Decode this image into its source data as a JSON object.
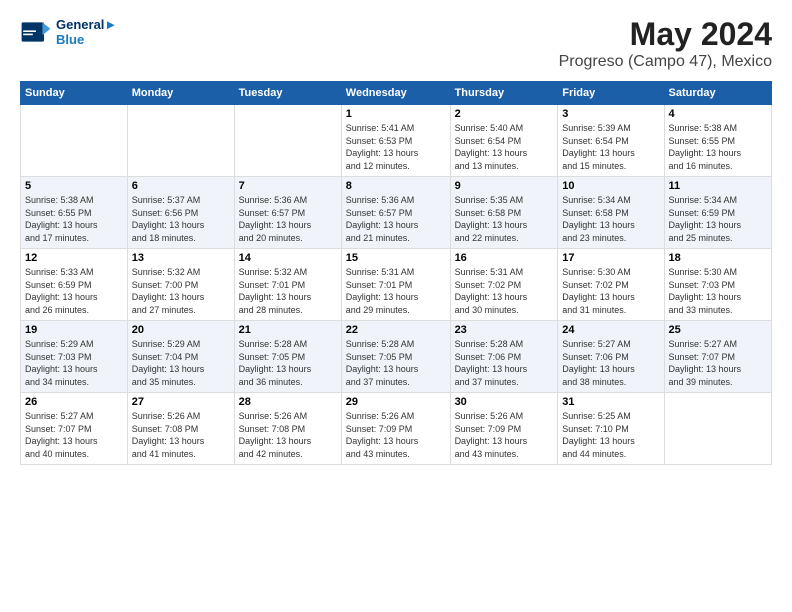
{
  "header": {
    "logo_line1": "General",
    "logo_line2": "Blue",
    "main_title": "May 2024",
    "subtitle": "Progreso (Campo 47), Mexico"
  },
  "days_of_week": [
    "Sunday",
    "Monday",
    "Tuesday",
    "Wednesday",
    "Thursday",
    "Friday",
    "Saturday"
  ],
  "weeks": [
    [
      {
        "day": "",
        "info": ""
      },
      {
        "day": "",
        "info": ""
      },
      {
        "day": "",
        "info": ""
      },
      {
        "day": "1",
        "info": "Sunrise: 5:41 AM\nSunset: 6:53 PM\nDaylight: 13 hours\nand 12 minutes."
      },
      {
        "day": "2",
        "info": "Sunrise: 5:40 AM\nSunset: 6:54 PM\nDaylight: 13 hours\nand 13 minutes."
      },
      {
        "day": "3",
        "info": "Sunrise: 5:39 AM\nSunset: 6:54 PM\nDaylight: 13 hours\nand 15 minutes."
      },
      {
        "day": "4",
        "info": "Sunrise: 5:38 AM\nSunset: 6:55 PM\nDaylight: 13 hours\nand 16 minutes."
      }
    ],
    [
      {
        "day": "5",
        "info": "Sunrise: 5:38 AM\nSunset: 6:55 PM\nDaylight: 13 hours\nand 17 minutes."
      },
      {
        "day": "6",
        "info": "Sunrise: 5:37 AM\nSunset: 6:56 PM\nDaylight: 13 hours\nand 18 minutes."
      },
      {
        "day": "7",
        "info": "Sunrise: 5:36 AM\nSunset: 6:57 PM\nDaylight: 13 hours\nand 20 minutes."
      },
      {
        "day": "8",
        "info": "Sunrise: 5:36 AM\nSunset: 6:57 PM\nDaylight: 13 hours\nand 21 minutes."
      },
      {
        "day": "9",
        "info": "Sunrise: 5:35 AM\nSunset: 6:58 PM\nDaylight: 13 hours\nand 22 minutes."
      },
      {
        "day": "10",
        "info": "Sunrise: 5:34 AM\nSunset: 6:58 PM\nDaylight: 13 hours\nand 23 minutes."
      },
      {
        "day": "11",
        "info": "Sunrise: 5:34 AM\nSunset: 6:59 PM\nDaylight: 13 hours\nand 25 minutes."
      }
    ],
    [
      {
        "day": "12",
        "info": "Sunrise: 5:33 AM\nSunset: 6:59 PM\nDaylight: 13 hours\nand 26 minutes."
      },
      {
        "day": "13",
        "info": "Sunrise: 5:32 AM\nSunset: 7:00 PM\nDaylight: 13 hours\nand 27 minutes."
      },
      {
        "day": "14",
        "info": "Sunrise: 5:32 AM\nSunset: 7:01 PM\nDaylight: 13 hours\nand 28 minutes."
      },
      {
        "day": "15",
        "info": "Sunrise: 5:31 AM\nSunset: 7:01 PM\nDaylight: 13 hours\nand 29 minutes."
      },
      {
        "day": "16",
        "info": "Sunrise: 5:31 AM\nSunset: 7:02 PM\nDaylight: 13 hours\nand 30 minutes."
      },
      {
        "day": "17",
        "info": "Sunrise: 5:30 AM\nSunset: 7:02 PM\nDaylight: 13 hours\nand 31 minutes."
      },
      {
        "day": "18",
        "info": "Sunrise: 5:30 AM\nSunset: 7:03 PM\nDaylight: 13 hours\nand 33 minutes."
      }
    ],
    [
      {
        "day": "19",
        "info": "Sunrise: 5:29 AM\nSunset: 7:03 PM\nDaylight: 13 hours\nand 34 minutes."
      },
      {
        "day": "20",
        "info": "Sunrise: 5:29 AM\nSunset: 7:04 PM\nDaylight: 13 hours\nand 35 minutes."
      },
      {
        "day": "21",
        "info": "Sunrise: 5:28 AM\nSunset: 7:05 PM\nDaylight: 13 hours\nand 36 minutes."
      },
      {
        "day": "22",
        "info": "Sunrise: 5:28 AM\nSunset: 7:05 PM\nDaylight: 13 hours\nand 37 minutes."
      },
      {
        "day": "23",
        "info": "Sunrise: 5:28 AM\nSunset: 7:06 PM\nDaylight: 13 hours\nand 37 minutes."
      },
      {
        "day": "24",
        "info": "Sunrise: 5:27 AM\nSunset: 7:06 PM\nDaylight: 13 hours\nand 38 minutes."
      },
      {
        "day": "25",
        "info": "Sunrise: 5:27 AM\nSunset: 7:07 PM\nDaylight: 13 hours\nand 39 minutes."
      }
    ],
    [
      {
        "day": "26",
        "info": "Sunrise: 5:27 AM\nSunset: 7:07 PM\nDaylight: 13 hours\nand 40 minutes."
      },
      {
        "day": "27",
        "info": "Sunrise: 5:26 AM\nSunset: 7:08 PM\nDaylight: 13 hours\nand 41 minutes."
      },
      {
        "day": "28",
        "info": "Sunrise: 5:26 AM\nSunset: 7:08 PM\nDaylight: 13 hours\nand 42 minutes."
      },
      {
        "day": "29",
        "info": "Sunrise: 5:26 AM\nSunset: 7:09 PM\nDaylight: 13 hours\nand 43 minutes."
      },
      {
        "day": "30",
        "info": "Sunrise: 5:26 AM\nSunset: 7:09 PM\nDaylight: 13 hours\nand 43 minutes."
      },
      {
        "day": "31",
        "info": "Sunrise: 5:25 AM\nSunset: 7:10 PM\nDaylight: 13 hours\nand 44 minutes."
      },
      {
        "day": "",
        "info": ""
      }
    ]
  ]
}
